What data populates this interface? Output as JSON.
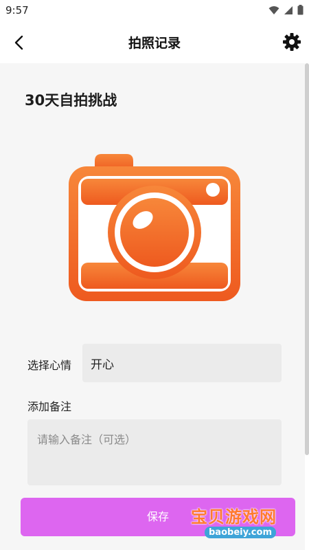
{
  "status_bar": {
    "time": "9:57",
    "icons": [
      "wifi-icon",
      "signal-icon",
      "battery-icon"
    ]
  },
  "header": {
    "title": "拍照记录",
    "back_icon": "back-arrow-icon",
    "settings_icon": "gear-icon"
  },
  "challenge": {
    "title": "30天自拍挑战",
    "camera_icon": "camera-icon",
    "accent_color": "#f36b2a"
  },
  "form": {
    "mood_label": "选择心情",
    "mood_value": "开心",
    "note_label": "添加备注",
    "note_placeholder": "请输入备注（可选）",
    "save_label": "保存",
    "save_color": "#dd66f0"
  },
  "watermark": {
    "text": "宝贝游戏网",
    "url": "baobeiy.com"
  }
}
